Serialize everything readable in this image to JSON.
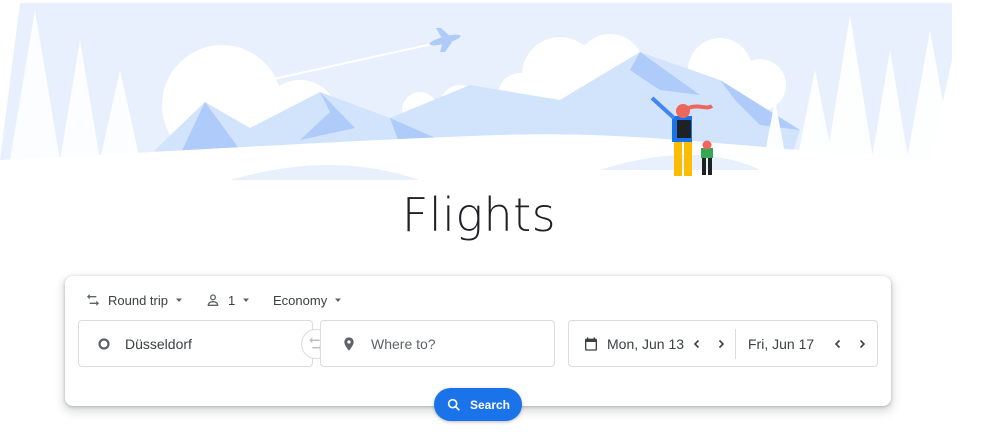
{
  "page": {
    "title": "Flights"
  },
  "colors": {
    "accent": "#1a73e8",
    "border": "#dadce0",
    "text": "#3c4043",
    "hero_sky": "#e8f0fe",
    "hero_mountain": "#aecbfa"
  },
  "options": {
    "trip_type": {
      "label": "Round trip",
      "icon": "swap-arrows-icon"
    },
    "passengers": {
      "label": "1",
      "icon": "person-icon"
    },
    "cabin_class": {
      "label": "Economy"
    }
  },
  "origin": {
    "value": "Düsseldorf",
    "icon": "circle-icon"
  },
  "swap": {
    "icon": "swap-horizontal-icon"
  },
  "destination": {
    "placeholder": "Where to?",
    "icon": "location-pin-icon"
  },
  "dates": {
    "icon": "calendar-icon",
    "departure": "Mon, Jun 13",
    "return": "Fri, Jun 17"
  },
  "search": {
    "label": "Search",
    "icon": "search-icon"
  }
}
